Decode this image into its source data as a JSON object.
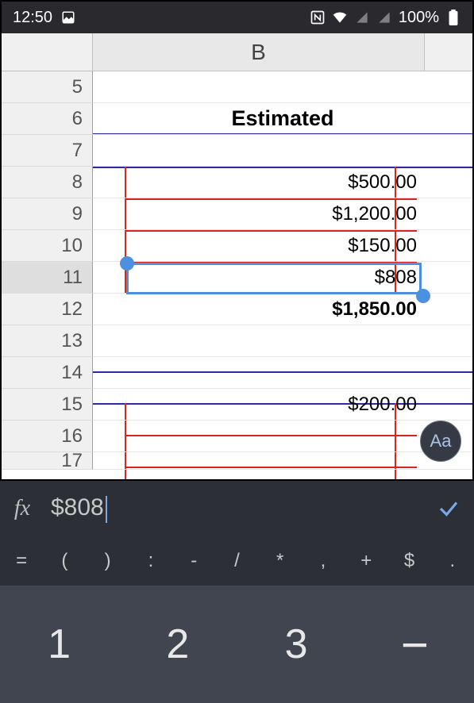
{
  "status": {
    "time": "12:50",
    "battery": "100%"
  },
  "column_label": "B",
  "rows": [
    {
      "n": "5",
      "v": ""
    },
    {
      "n": "6",
      "v": "Estimated"
    },
    {
      "n": "7",
      "v": ""
    },
    {
      "n": "8",
      "v": "$500.00"
    },
    {
      "n": "9",
      "v": "$1,200.00"
    },
    {
      "n": "10",
      "v": "$150.00"
    },
    {
      "n": "11",
      "v": "$808"
    },
    {
      "n": "12",
      "v": "$1,850.00"
    },
    {
      "n": "13",
      "v": ""
    },
    {
      "n": "14",
      "v": ""
    },
    {
      "n": "15",
      "v": "$200.00"
    },
    {
      "n": "16",
      "v": ""
    },
    {
      "n": "17",
      "v": ""
    }
  ],
  "formula": "$808",
  "fab_label": "Aa",
  "symbols": [
    "=",
    "(",
    ")",
    ":",
    "-",
    "/",
    "*",
    ",",
    "+",
    "$",
    "."
  ],
  "numpad": [
    "1",
    "2",
    "3",
    "−"
  ],
  "chart_data": {
    "type": "table",
    "title": "Estimated",
    "rows": [
      {
        "row": 8,
        "value": 500.0
      },
      {
        "row": 9,
        "value": 1200.0
      },
      {
        "row": 10,
        "value": 150.0
      },
      {
        "row": 11,
        "value": 808
      },
      {
        "row": 12,
        "value": 1850.0
      },
      {
        "row": 15,
        "value": 200.0
      }
    ],
    "selected_cell": "B11",
    "editing_value": "$808"
  }
}
